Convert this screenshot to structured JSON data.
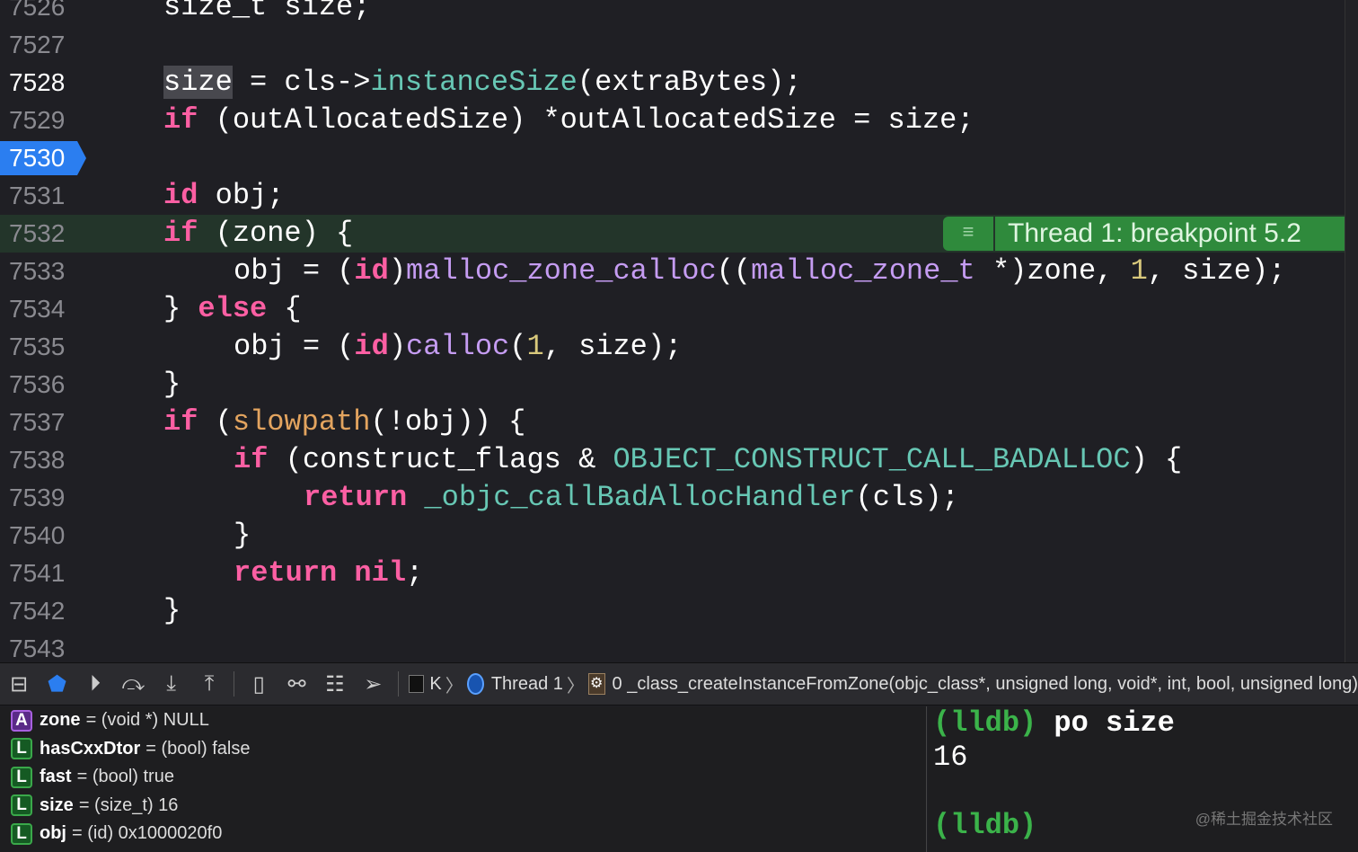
{
  "editor": {
    "current_line": "7528",
    "breakpoint_line": "7530",
    "highlight_line": "7532",
    "annotation": {
      "icon": "list-icon",
      "text": "Thread 1: breakpoint 5.2"
    },
    "lines": [
      {
        "n": "7526",
        "i": 0,
        "t": [
          [
            "size_t size;",
            ""
          ]
        ]
      },
      {
        "n": "7527",
        "i": 0,
        "t": []
      },
      {
        "n": "7528",
        "i": 0,
        "t": [
          [
            "size",
            "sel"
          ],
          [
            " = cls->",
            ""
          ],
          [
            "instanceSize",
            "fn"
          ],
          [
            "(extraBytes);",
            ""
          ]
        ]
      },
      {
        "n": "7529",
        "i": 0,
        "t": [
          [
            "if",
            "kw"
          ],
          [
            " (outAllocatedSize) *outAllocatedSize = size;",
            ""
          ]
        ]
      },
      {
        "n": "7530",
        "i": 0,
        "t": []
      },
      {
        "n": "7531",
        "i": 0,
        "t": [
          [
            "id",
            "kw"
          ],
          [
            " obj;",
            ""
          ]
        ]
      },
      {
        "n": "7532",
        "i": 0,
        "t": [
          [
            "if",
            "kw"
          ],
          [
            " (zone) {",
            ""
          ]
        ]
      },
      {
        "n": "7533",
        "i": 1,
        "t": [
          [
            "obj = (",
            ""
          ],
          [
            "id",
            "kw"
          ],
          [
            ")",
            ""
          ],
          [
            "malloc_zone_calloc",
            "fp"
          ],
          [
            "((",
            ""
          ],
          [
            "malloc_zone_t",
            "fp"
          ],
          [
            " *)zone, ",
            ""
          ],
          [
            "1",
            "num"
          ],
          [
            ", size);",
            ""
          ]
        ]
      },
      {
        "n": "7534",
        "i": 0,
        "t": [
          [
            "} ",
            ""
          ],
          [
            "else",
            "kw"
          ],
          [
            " {",
            ""
          ]
        ]
      },
      {
        "n": "7535",
        "i": 1,
        "t": [
          [
            "obj = (",
            ""
          ],
          [
            "id",
            "kw"
          ],
          [
            ")",
            ""
          ],
          [
            "calloc",
            "fp"
          ],
          [
            "(",
            ""
          ],
          [
            "1",
            "num"
          ],
          [
            ", size);",
            ""
          ]
        ]
      },
      {
        "n": "7536",
        "i": 0,
        "t": [
          [
            "}",
            ""
          ]
        ]
      },
      {
        "n": "7537",
        "i": 0,
        "t": [
          [
            "if",
            "kw"
          ],
          [
            " (",
            ""
          ],
          [
            "slowpath",
            "sp"
          ],
          [
            "(!obj)) {",
            ""
          ]
        ]
      },
      {
        "n": "7538",
        "i": 1,
        "t": [
          [
            "if",
            "kw"
          ],
          [
            " (construct_flags & ",
            ""
          ],
          [
            "OBJECT_CONSTRUCT_CALL_BADALLOC",
            "fn"
          ],
          [
            ") {",
            ""
          ]
        ]
      },
      {
        "n": "7539",
        "i": 2,
        "t": [
          [
            "return",
            "kw"
          ],
          [
            " ",
            ""
          ],
          [
            "_objc_callBadAllocHandler",
            "fn"
          ],
          [
            "(cls);",
            ""
          ]
        ]
      },
      {
        "n": "7540",
        "i": 1,
        "t": [
          [
            "}",
            ""
          ]
        ]
      },
      {
        "n": "7541",
        "i": 1,
        "t": [
          [
            "return",
            "kw"
          ],
          [
            " ",
            ""
          ],
          [
            "nil",
            "kw"
          ],
          [
            ";",
            ""
          ]
        ]
      },
      {
        "n": "7542",
        "i": 0,
        "t": [
          [
            "}",
            ""
          ]
        ]
      },
      {
        "n": "7543",
        "i": 0,
        "t": []
      }
    ]
  },
  "debugbar": {
    "process": "K",
    "thread": "Thread 1",
    "frame": "0 _class_createInstanceFromZone(objc_class*, unsigned long, void*, int, bool, unsigned long)"
  },
  "variables": [
    {
      "kind": "A",
      "name": "zone",
      "value": "= (void *) NULL"
    },
    {
      "kind": "L",
      "name": "hasCxxDtor",
      "value": "= (bool) false"
    },
    {
      "kind": "L",
      "name": "fast",
      "value": "= (bool) true"
    },
    {
      "kind": "L",
      "name": "size",
      "value": "= (size_t) 16"
    },
    {
      "kind": "L",
      "name": "obj",
      "value": "= (id) 0x1000020f0"
    }
  ],
  "console": {
    "prompt": "(lldb)",
    "command": " po size",
    "output": "16",
    "watermark": "@稀土掘金技术社区"
  }
}
